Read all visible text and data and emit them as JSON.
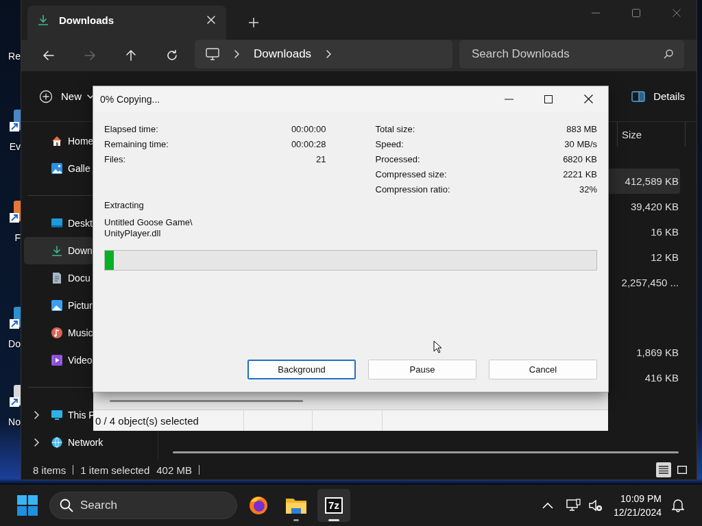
{
  "desktop_icons": [
    {
      "label": "Re"
    },
    {
      "label": "Ev"
    },
    {
      "label": "F"
    },
    {
      "label": "Do"
    },
    {
      "label": "No"
    }
  ],
  "explorer": {
    "tab": {
      "title": "Downloads",
      "selected": true
    },
    "nav": [
      {
        "kind": "back",
        "disabled": false
      },
      {
        "kind": "forward",
        "disabled": true
      },
      {
        "kind": "up",
        "disabled": false
      },
      {
        "kind": "refresh",
        "disabled": false
      }
    ],
    "address": {
      "crumbs": [
        "Downloads"
      ]
    },
    "search": {
      "placeholder": "Search Downloads"
    },
    "toolbar": {
      "new_label": "New",
      "details_label": "Details"
    },
    "sidebar": {
      "groups": [
        [
          {
            "kind": "home",
            "label": "Home",
            "selected": false
          },
          {
            "kind": "gallery",
            "label": "Galle",
            "selected": false
          }
        ],
        [
          {
            "kind": "desktop",
            "label": "Deskt",
            "selected": false
          },
          {
            "kind": "downloads",
            "label": "Down",
            "selected": true
          },
          {
            "kind": "documents",
            "label": "Docu",
            "selected": false
          },
          {
            "kind": "pictures",
            "label": "Pictur",
            "selected": false
          },
          {
            "kind": "music",
            "label": "Music",
            "selected": false
          },
          {
            "kind": "videos",
            "label": "Video",
            "selected": false
          }
        ],
        [
          {
            "kind": "pc",
            "label": "This P",
            "selected": false,
            "expanded": false
          },
          {
            "kind": "network",
            "label": "Network",
            "selected": false,
            "expanded": false
          }
        ]
      ]
    },
    "columns": [
      {
        "label": "Size"
      }
    ],
    "rows": [
      {
        "size": "412,589 KB",
        "selected": true
      },
      {
        "size": "39,420 KB",
        "selected": false
      },
      {
        "size": "16 KB",
        "selected": false
      },
      {
        "size": "12 KB",
        "selected": false
      },
      {
        "size": "2,257,450 ...",
        "selected": false
      },
      {
        "size": "1,869 KB",
        "selected": false
      },
      {
        "size": "416 KB",
        "selected": false
      }
    ],
    "status": {
      "count": "8 items",
      "selection": "1 item selected",
      "selection_size": "402 MB"
    },
    "view_buttons": [
      {
        "kind": "details",
        "selected": true
      },
      {
        "kind": "tiles",
        "selected": false
      }
    ]
  },
  "zip_window": {
    "status": "0 / 4 object(s) selected"
  },
  "dialog": {
    "title": "0% Copying...",
    "stats_left": [
      {
        "label": "Elapsed time:",
        "value": "00:00:00"
      },
      {
        "label": "Remaining time:",
        "value": "00:00:28"
      },
      {
        "label": "Files:",
        "value": "21"
      }
    ],
    "stats_right": [
      {
        "label": "Total size:",
        "value": "883 MB"
      },
      {
        "label": "Speed:",
        "value": "30 MB/s"
      },
      {
        "label": "Processed:",
        "value": "6820 KB"
      },
      {
        "label": "Compressed size:",
        "value": "2221 KB"
      },
      {
        "label": "Compression ratio:",
        "value": "32%"
      }
    ],
    "operation": "Extracting",
    "file_lines": [
      "Untitled Goose Game\\",
      "UnityPlayer.dll"
    ],
    "progress": {
      "level": 0.018
    },
    "buttons": [
      {
        "label": "Background",
        "default": true
      },
      {
        "label": "Pause",
        "default": false
      },
      {
        "label": "Cancel",
        "default": false
      }
    ]
  },
  "taskbar": {
    "search_label": "Search",
    "apps": [
      {
        "kind": "firefox",
        "running": false,
        "active": false
      },
      {
        "kind": "explorer",
        "running": true,
        "active": false
      },
      {
        "kind": "sevenzip",
        "label": "7z",
        "running": true,
        "active": true
      }
    ],
    "time": "10:09 PM",
    "date": "12/21/2024"
  }
}
